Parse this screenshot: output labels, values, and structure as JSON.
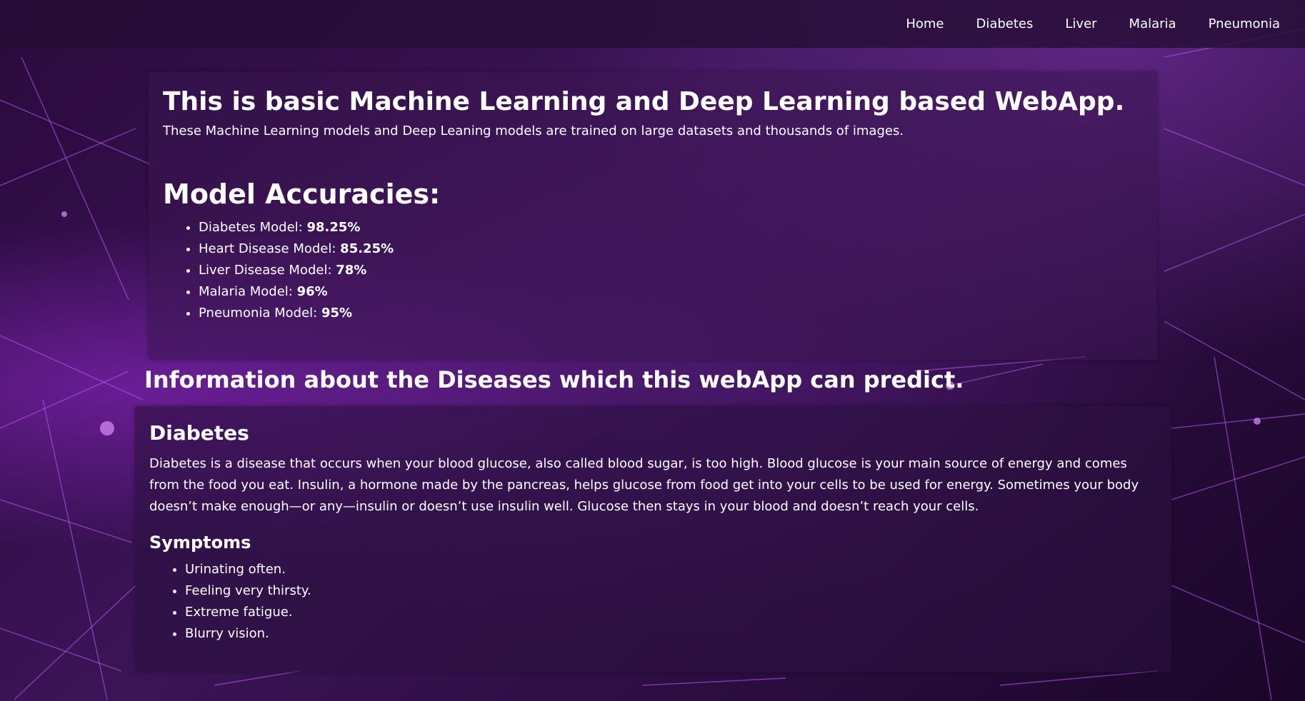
{
  "nav": {
    "items": [
      {
        "label": "Home"
      },
      {
        "label": "Diabetes"
      },
      {
        "label": "Liver"
      },
      {
        "label": "Malaria"
      },
      {
        "label": "Pneumonia"
      }
    ]
  },
  "intro": {
    "title": "This is basic Machine Learning and Deep Learning based WebApp.",
    "subtitle": "These Machine Learning models and Deep Leaning models are trained on large datasets and thousands of images."
  },
  "accuracies": {
    "title": "Model Accuracies:",
    "items": [
      {
        "label": "Diabetes Model: ",
        "value": "98.25%"
      },
      {
        "label": "Heart Disease Model: ",
        "value": "85.25%"
      },
      {
        "label": "Liver Disease Model: ",
        "value": "78%"
      },
      {
        "label": "Malaria Model: ",
        "value": "96%"
      },
      {
        "label": "Pneumonia Model: ",
        "value": "95%"
      }
    ]
  },
  "info": {
    "heading": "Information about the Diseases which this webApp can predict."
  },
  "diabetes": {
    "title": "Diabetes",
    "description": "Diabetes is a disease that occurs when your blood glucose, also called blood sugar, is too high. Blood glucose is your main source of energy and comes from the food you eat. Insulin, a hormone made by the pancreas, helps glucose from food get into your cells to be used for energy. Sometimes your body doesn’t make enough—or any—insulin or doesn’t use insulin well. Glucose then stays in your blood and doesn’t reach your cells.",
    "symptoms_title": "Symptoms",
    "symptoms": [
      "Urinating often.",
      "Feeling very thirsty.",
      "Extreme fatigue.",
      "Blurry vision."
    ]
  },
  "colors": {
    "accent": "#8a2be2",
    "navbar": "#240e34",
    "text": "#ffffff"
  }
}
